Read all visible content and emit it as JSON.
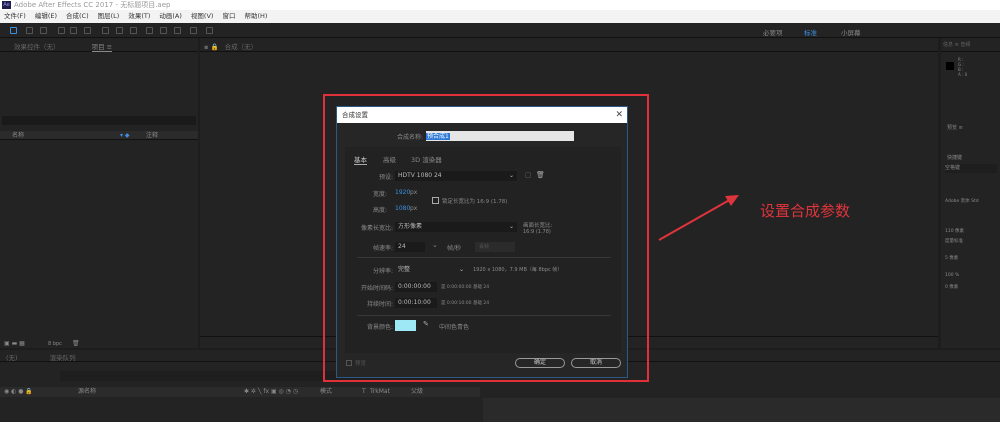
{
  "window": {
    "title": "Adobe After Effects CC 2017 - 无标题项目.aep",
    "logo": "Ae"
  },
  "menu": [
    "文件(F)",
    "编辑(E)",
    "合成(C)",
    "图层(L)",
    "效果(T)",
    "动画(A)",
    "视图(V)",
    "窗口",
    "帮助(H)"
  ],
  "workspaces": [
    "必要项",
    "标准",
    "小屏幕"
  ],
  "workspace_active": "标准",
  "project": {
    "tabs": [
      "效果控件（无）",
      "项目 ≡"
    ],
    "col_name": "名称",
    "col_comment": "注释",
    "bpc": "8 bpc"
  },
  "viewer": {
    "tab": "合成（无）"
  },
  "right": {
    "tabs": [
      "信息 ≡",
      "音频"
    ],
    "info": [
      "R :",
      "G :",
      "B :",
      "A : 0"
    ],
    "preview": "预览 ≡",
    "shortcut_label": "快捷键",
    "shortcut": "空格键",
    "font": "Adobe 黑体 Std",
    "size1": "110 像素",
    "size2": "度量标准",
    "leading": "5 像素",
    "scale": "100 %",
    "baseline": "0 像素"
  },
  "timeline": {
    "tab": "(无)",
    "render_queue": "渲染队列",
    "cols": {
      "source": "源名称",
      "mode": "模式",
      "t": "T",
      "trkmat": "TrkMat",
      "parent": "父级"
    }
  },
  "dialog": {
    "title": "合成设置",
    "name_label": "合成名称:",
    "name_value": "预合成1",
    "tabs": [
      "基本",
      "高级",
      "3D 渲染器"
    ],
    "preset_label": "预设:",
    "preset": "HDTV 1080 24",
    "width_label": "宽度:",
    "width": "1920",
    "height_label": "高度:",
    "height": "1080",
    "px": "px",
    "lock_aspect": "锁定长宽比为 16:9 (1.78)",
    "pixel_aspect_label": "像素长宽比:",
    "pixel_aspect": "方形像素",
    "frame_aspect_label": "画面长宽比:",
    "frame_aspect": "16:9 (1.78)",
    "fps_label": "帧速率:",
    "fps": "24",
    "fps_unit": "帧/秒",
    "drop_frame": "丢帧",
    "resolution_label": "分辨率:",
    "resolution": "完整",
    "res_info": "1920 x 1080，7.9 MB（每 8bpc 帧）",
    "start_label": "开始时间码:",
    "start": "0:00:00:00",
    "start_info": "是 0:00:00:00  基础 24",
    "duration_label": "持续时间:",
    "duration": "0:00:10:00",
    "duration_info": "是 0:00:10:00  基础 24",
    "bg_label": "背景颜色:",
    "bg_color": "#9ee8f6",
    "bg_name": "中间色青色",
    "preview": "预览",
    "ok": "确定",
    "cancel": "取消"
  },
  "annotation": "设置合成参数",
  "colors": {
    "accent": "#3d8fe0",
    "annotation": "#e0343c"
  }
}
